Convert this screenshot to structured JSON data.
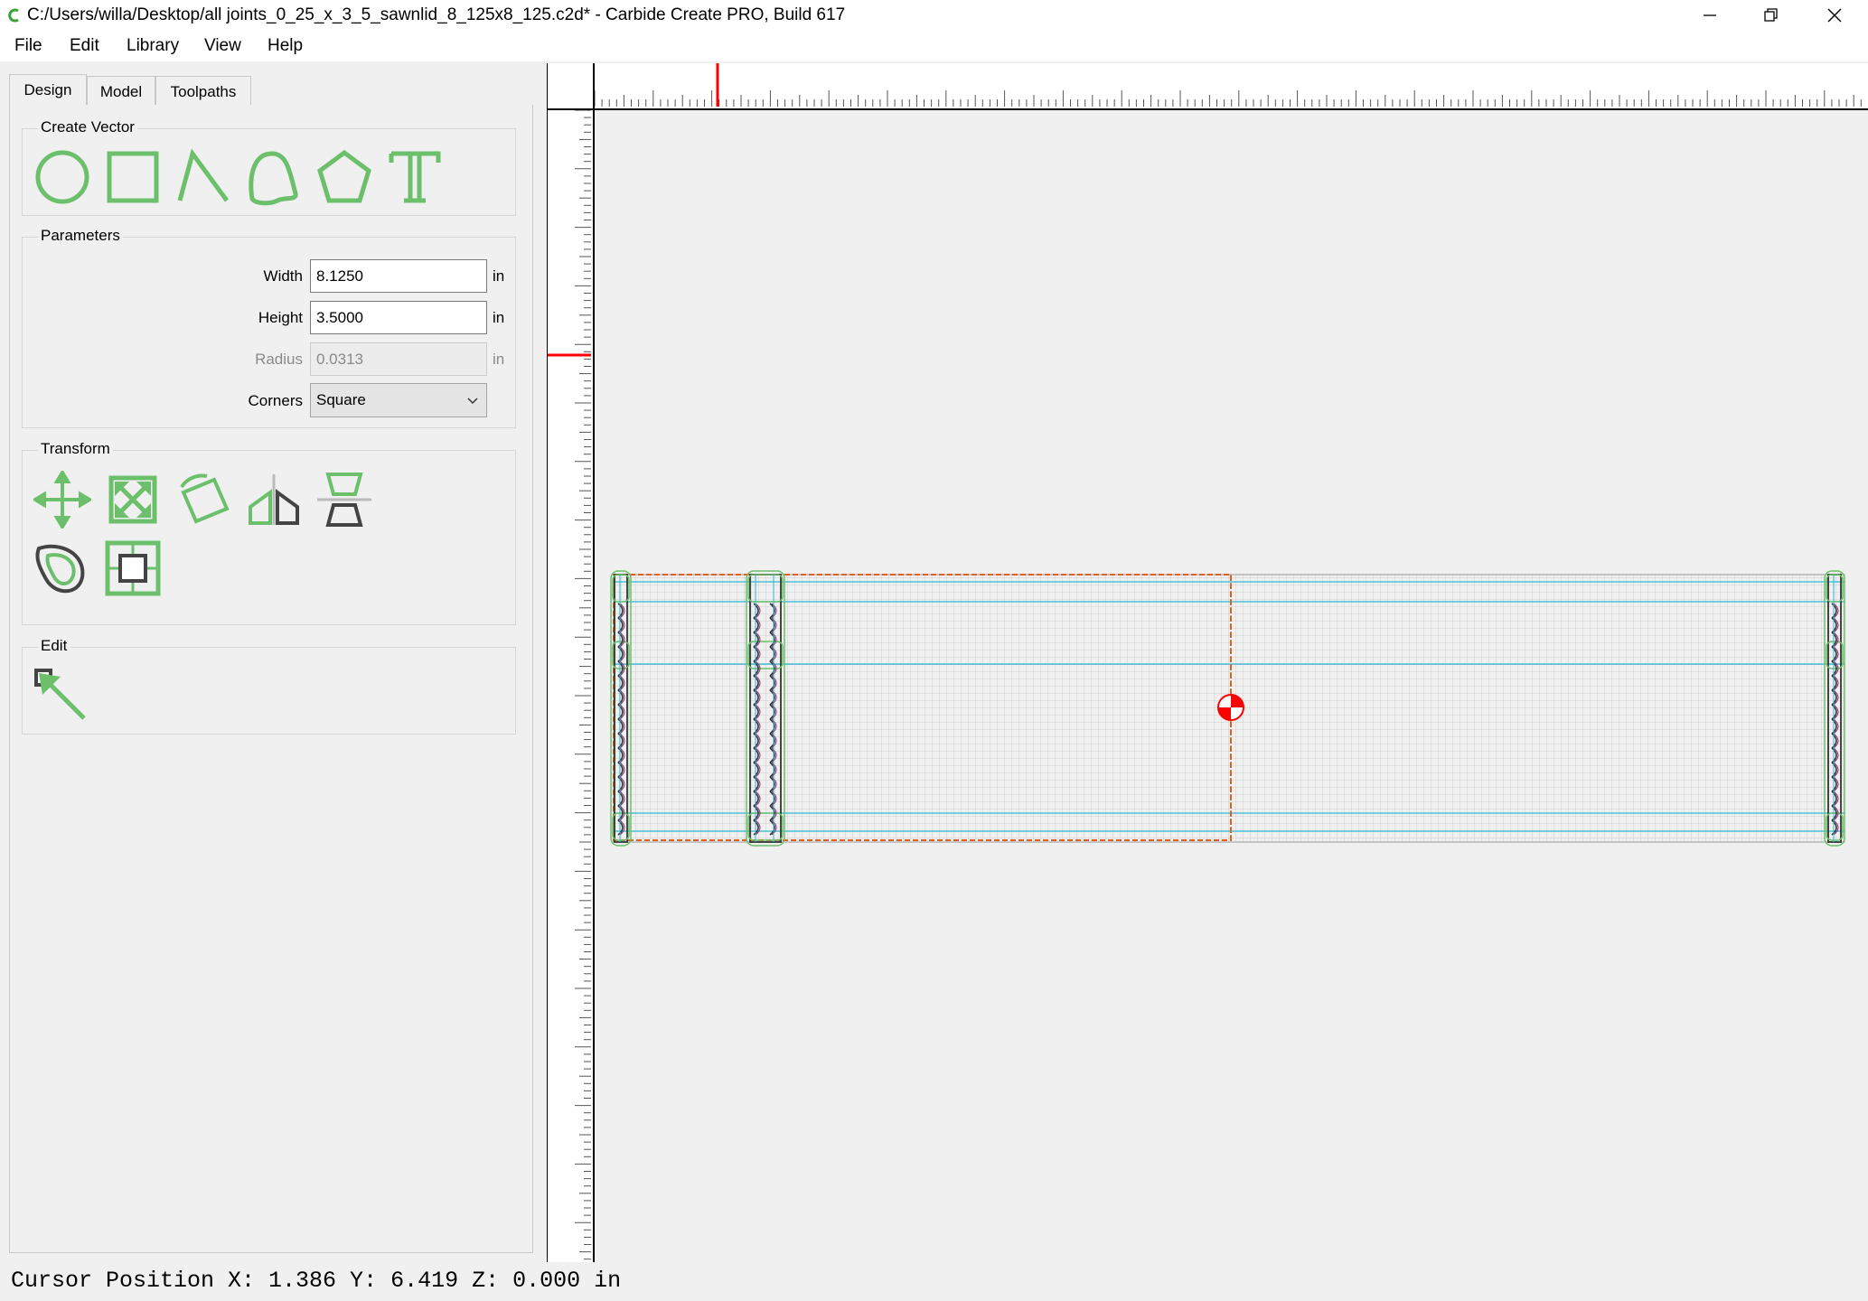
{
  "window": {
    "title": "C:/Users/willa/Desktop/all joints_0_25_x_3_5_sawnlid_8_125x8_125.c2d* - Carbide Create PRO, Build 617"
  },
  "menu": {
    "items": [
      "File",
      "Edit",
      "Library",
      "View",
      "Help"
    ]
  },
  "tabs": [
    {
      "label": "Design",
      "active": true
    },
    {
      "label": "Model",
      "active": false
    },
    {
      "label": "Toolpaths",
      "active": false
    }
  ],
  "create_vector": {
    "title": "Create Vector",
    "tools": [
      "circle-icon",
      "rectangle-icon",
      "polyline-icon",
      "curve-icon",
      "polygon-icon",
      "text-icon"
    ]
  },
  "parameters": {
    "title": "Parameters",
    "width": {
      "label": "Width",
      "value": "8.1250",
      "unit": "in"
    },
    "height": {
      "label": "Height",
      "value": "3.5000",
      "unit": "in"
    },
    "radius": {
      "label": "Radius",
      "value": "0.0313",
      "unit": "in",
      "disabled": true
    },
    "corners": {
      "label": "Corners",
      "value": "Square"
    }
  },
  "transform": {
    "title": "Transform",
    "tools": [
      "move-icon",
      "scale-icon",
      "rotate-icon",
      "mirror-icon",
      "align-icon",
      "offset-icon",
      "boolean-icon"
    ]
  },
  "edit": {
    "title": "Edit",
    "tools": [
      "node-edit-icon"
    ]
  },
  "status": {
    "text": "Cursor Position X: 1.386 Y: 6.419 Z: 0.000 in"
  },
  "colors": {
    "accent_green": "#6cc06c",
    "ruler_marker": "#ff0000",
    "stock_outline": "#e06020",
    "grid_blue": "#29b6d8"
  }
}
